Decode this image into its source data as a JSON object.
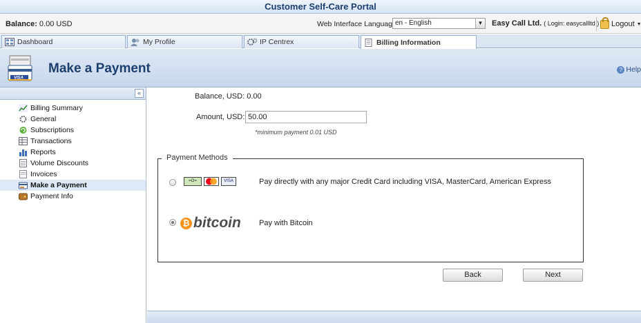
{
  "app": {
    "title": "Customer Self-Care Portal"
  },
  "infobar": {
    "balance_label": "Balance:",
    "balance_value": "0.00 USD",
    "lang_label": "Web Interface Language:",
    "lang_value": "en - English",
    "company": "Easy Call Ltd.",
    "login_text": "( Login: easycallltd )",
    "logout_label": "Logout"
  },
  "tabs": [
    {
      "label": "Dashboard"
    },
    {
      "label": "My Profile"
    },
    {
      "label": "IP Centrex"
    },
    {
      "label": "Billing Information"
    }
  ],
  "header": {
    "title": "Make a Payment",
    "help_label": "Help"
  },
  "sidebar": {
    "items": [
      {
        "label": "Billing Summary"
      },
      {
        "label": "General"
      },
      {
        "label": "Subscriptions"
      },
      {
        "label": "Transactions"
      },
      {
        "label": "Reports"
      },
      {
        "label": "Volume Discounts"
      },
      {
        "label": "Invoices"
      },
      {
        "label": "Make a Payment"
      },
      {
        "label": "Payment Info"
      }
    ]
  },
  "form": {
    "balance_label": "Balance, USD: 0.00",
    "amount_label": "Amount, USD:",
    "amount_value": "50.00",
    "hint": "*minimum payment 0.01 USD",
    "methods_legend": "Payment Methods",
    "cc_text": "Pay directly with any major Credit Card including VISA, MasterCard, American Express",
    "btc_word": "bitcoin",
    "btc_text": "Pay with Bitcoin",
    "back_label": "Back",
    "next_label": "Next"
  },
  "colors": {
    "brand": "#1d3f6e",
    "bitcoin": "#f7931a"
  }
}
